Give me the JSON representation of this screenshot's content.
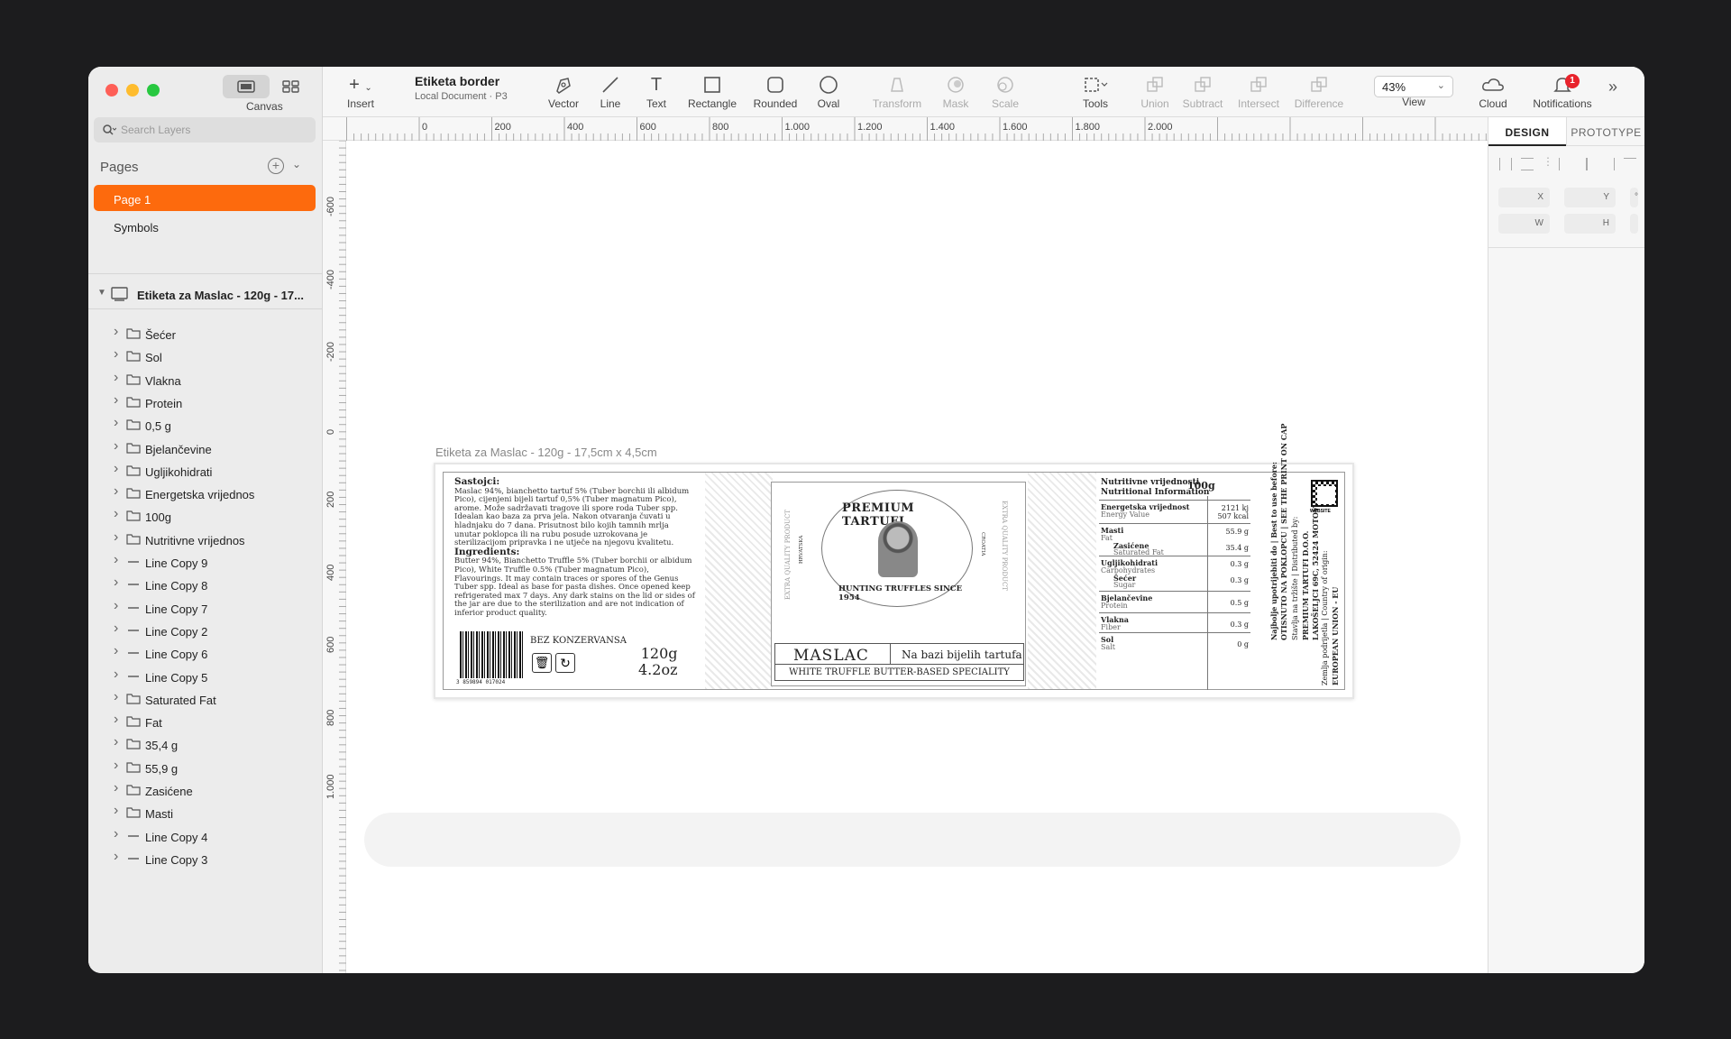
{
  "sidebar": {
    "canvas_label": "Canvas",
    "search_placeholder": "Search Layers",
    "pages_title": "Pages",
    "pages": [
      {
        "label": "Page 1",
        "active": true
      },
      {
        "label": "Symbols",
        "active": false
      }
    ],
    "document_layer": "Etiketa za Maslac - 120g - 17...",
    "layers": [
      {
        "label": "Šećer",
        "type": "group"
      },
      {
        "label": "Sol",
        "type": "group"
      },
      {
        "label": "Vlakna",
        "type": "group"
      },
      {
        "label": "Protein",
        "type": "group"
      },
      {
        "label": "0,5 g",
        "type": "group"
      },
      {
        "label": "Bjelančevine",
        "type": "group"
      },
      {
        "label": "Ugljikohidrati",
        "type": "group"
      },
      {
        "label": "Energetska vrijednos",
        "type": "group"
      },
      {
        "label": "100g",
        "type": "group"
      },
      {
        "label": "Nutritivne vrijednos",
        "type": "group"
      },
      {
        "label": "Line Copy 9",
        "type": "line"
      },
      {
        "label": "Line Copy 8",
        "type": "line"
      },
      {
        "label": "Line Copy 7",
        "type": "line"
      },
      {
        "label": "Line Copy 2",
        "type": "line"
      },
      {
        "label": "Line Copy 6",
        "type": "line"
      },
      {
        "label": "Line Copy 5",
        "type": "line"
      },
      {
        "label": "Saturated Fat",
        "type": "group"
      },
      {
        "label": "Fat",
        "type": "group"
      },
      {
        "label": "35,4 g",
        "type": "group"
      },
      {
        "label": "55,9 g",
        "type": "group"
      },
      {
        "label": "Zasićene",
        "type": "group"
      },
      {
        "label": "Masti",
        "type": "group"
      },
      {
        "label": "Line Copy 4",
        "type": "line"
      },
      {
        "label": "Line Copy 3",
        "type": "line"
      }
    ]
  },
  "toolbar": {
    "insert": "Insert",
    "doc_title": "Etiketa border",
    "doc_subtitle": "Local Document · P3",
    "tools": [
      "Vector",
      "Line",
      "Text",
      "Rectangle",
      "Rounded",
      "Oval"
    ],
    "disabled_tools": [
      "Transform",
      "Mask",
      "Scale"
    ],
    "tools_menu": "Tools",
    "boolean_ops": [
      "Union",
      "Subtract",
      "Intersect",
      "Difference"
    ],
    "zoom": "43%",
    "view": "View",
    "cloud": "Cloud",
    "notifications": "Notifications",
    "notification_count": "1"
  },
  "rulers": {
    "top": [
      "0",
      "200",
      "400",
      "600",
      "800",
      "1.000",
      "1.200",
      "1.400",
      "1.600",
      "1.800",
      "2.000"
    ],
    "left": [
      "-600",
      "-400",
      "-200",
      "0",
      "200",
      "400",
      "600",
      "800",
      "1.000"
    ]
  },
  "canvas": {
    "artboard_name": "Etiketa za Maslac - 120g - 17,5cm x 4,5cm",
    "label": {
      "sastojci_title": "Sastojci:",
      "sastojci_text": "Maslac 94%, bianchetto tartuf 5% (Tuber borchii ili albidum Pico), cijenjeni bijeli tartuf 0,5% (Tuber magnatum Pico), arome. Može sadržavati tragove ili spore roda Tuber spp. Idealan kao baza za prva jela. Nakon otvaranja čuvati u hladnjaku do 7 dana. Prisutnost bilo kojih tamnih mrlja unutar poklopca ili na rubu posude uzrokovana je sterilizacijom pripravka i ne utječe na njegovu kvalitetu.",
      "ingredients_title": "Ingredients:",
      "ingredients_text": "Butter 94%, Bianchetto Truffle 5% (Tuber borchii or albidum Pico), White Truffle 0.5% (Tuber magnatum Pico), Flavourings. It may contain traces or spores of the Genus Tuber spp. Ideal as base for pasta dishes. Once opened keep refrigerated max 7 days. Any dark stains on the lid or sides of the jar are due to the sterilization and are not indication of inferior product quality.",
      "barcode_number": "3 859894 017024",
      "no_preservatives": "BEZ KONZERVANSA",
      "weight_g": "120g",
      "weight_oz": "4.2oz",
      "medallion_top": "PREMIUM TARTUFI",
      "medallion_bottom": "HUNTING TRUFFLES SINCE 1954",
      "medallion_left": "HRVATSKA",
      "medallion_right": "CROATIA",
      "side_left": "EXTRA QUALITY PRODUCT",
      "side_right": "EXTRA QUALITY PRODUCT",
      "product_name": "MASLAC",
      "product_sub": "Na bazi bijelih tartufa",
      "product_en": "WHITE TRUFFLE BUTTER-BASED SPECIALITY",
      "nutri_title_hr": "Nutritivne vrijednosti",
      "nutri_title_en": "Nutritional Information",
      "nutri_per": "100g",
      "nutrition": [
        {
          "hr": "Energetska vrijednost",
          "en": "Energy Value",
          "values": [
            "2121 kj",
            "507 kcal"
          ]
        },
        {
          "hr": "Masti",
          "en": "Fat",
          "sub_hr": "Zasićene",
          "sub_en": "Saturated Fat",
          "values": [
            "55.9 g",
            "35.4 g"
          ]
        },
        {
          "hr": "Ugljikohidrati",
          "en": "Carbohydrates",
          "sub_hr": "Šećer",
          "sub_en": "Sugar",
          "values": [
            "0.3 g",
            "0.3 g"
          ]
        },
        {
          "hr": "Bjelančevine",
          "en": "Protein",
          "values": [
            "0.5 g"
          ]
        },
        {
          "hr": "Vlakna",
          "en": "Fiber",
          "values": [
            "0.3 g"
          ]
        },
        {
          "hr": "Sol",
          "en": "Salt",
          "values": [
            "0 g"
          ]
        }
      ],
      "best_before": "Najbolje upotrijebiti do | Best to use before:",
      "printed_cap": "OTISNUTO NA POKLOPCU | SEE THE PRINT ON CAP",
      "distributed": "Stavlja na tržište | Distributed by:",
      "company": "PREMIUM TARTUFI D.O.O.",
      "address": "LAKOŠELJCI 69C, 52424 MOTOVUN",
      "origin": "Zemlja podrijetla | Country of origin:",
      "origin_value": "EUROPEAN UNION - EU",
      "website": "WEBSITE"
    }
  },
  "right_panel": {
    "tab_design": "DESIGN",
    "tab_prototype": "PROTOTYPE",
    "fields": {
      "x": "X",
      "y": "Y",
      "rotation": "°",
      "w": "W",
      "h": "H"
    }
  }
}
